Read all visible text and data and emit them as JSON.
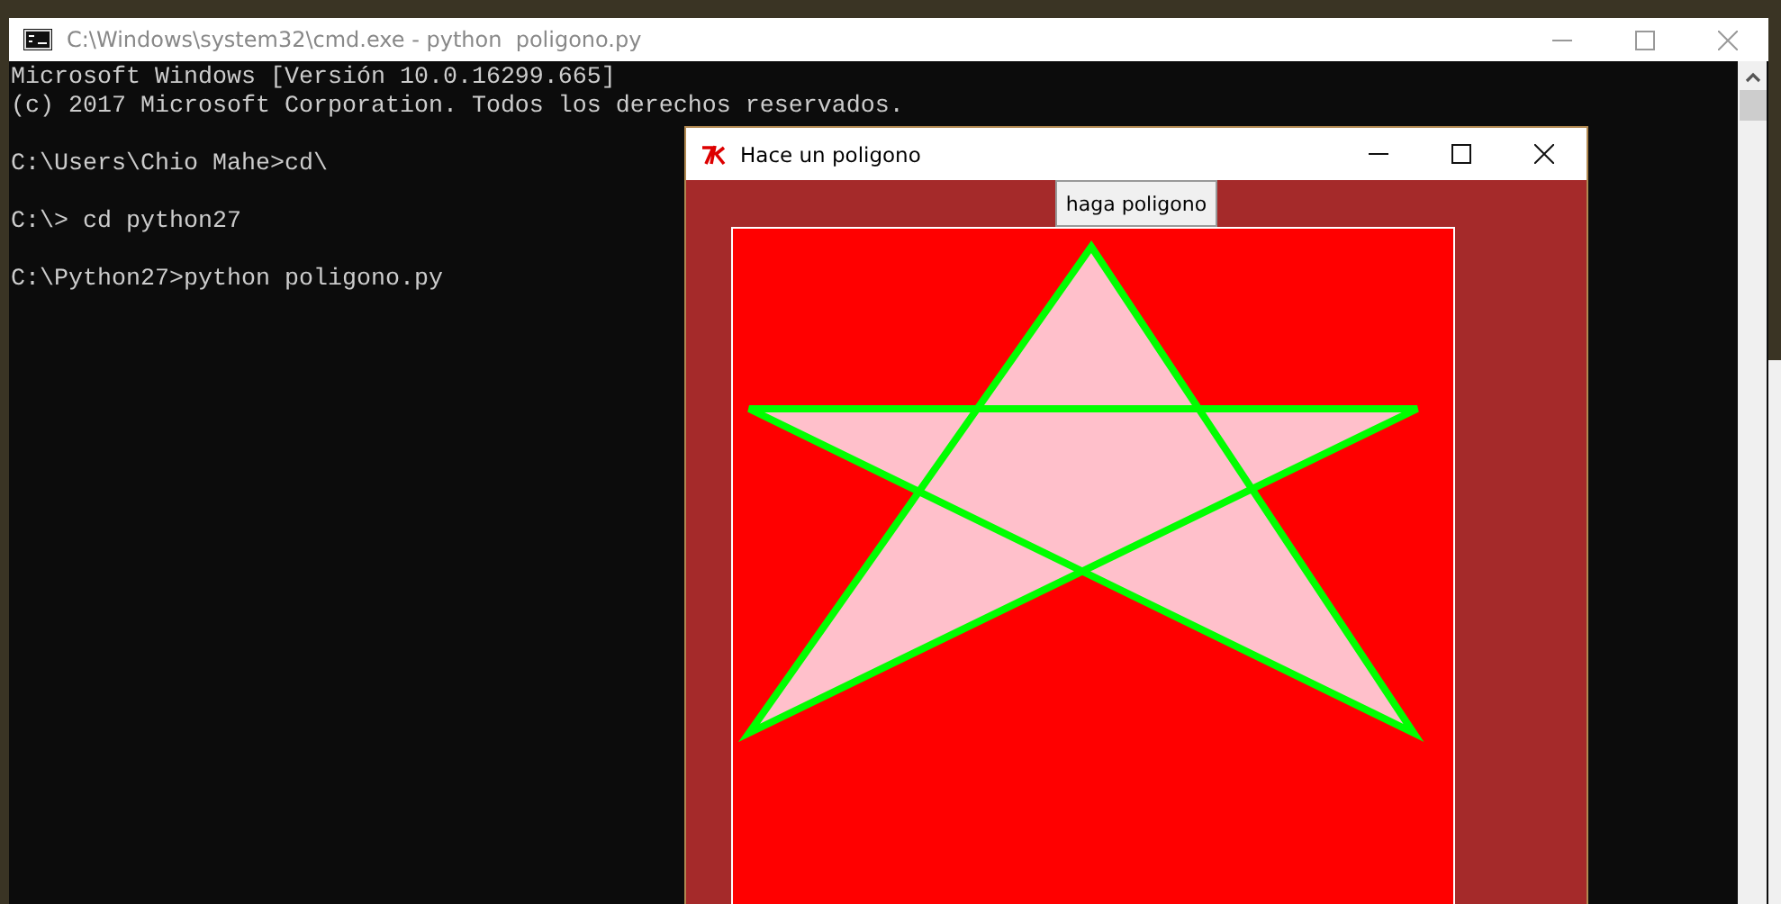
{
  "cmd_window": {
    "title": "C:\\Windows\\system32\\cmd.exe - python  poligono.py",
    "blocks": [
      [
        "Microsoft Windows [Versión 10.0.16299.665]",
        "(c) 2017 Microsoft Corporation. Todos los derechos reservados."
      ],
      [
        "C:\\Users\\Chio Mahe>cd\\"
      ],
      [
        "C:\\> cd python27"
      ],
      [
        "C:\\Python27>python poligono.py"
      ]
    ]
  },
  "tk_window": {
    "title": "Hace un poligono",
    "button": "haga poligono"
  }
}
